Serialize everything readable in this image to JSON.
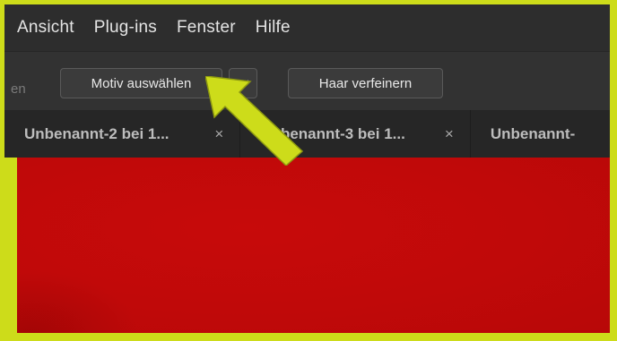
{
  "menubar": {
    "items": [
      {
        "label": "Ansicht"
      },
      {
        "label": "Plug-ins"
      },
      {
        "label": "Fenster"
      },
      {
        "label": "Hilfe"
      }
    ]
  },
  "options_bar": {
    "partial_label": "en",
    "select_subject_label": "Motiv auswählen",
    "refine_hair_label": "Haar verfeinern",
    "dropdown_icon": "chevron-down-icon"
  },
  "tabs": [
    {
      "label": "Unbenannt-2 bei 1...",
      "close": "×"
    },
    {
      "label": "Unbenannt-3 bei 1...",
      "close": "×"
    },
    {
      "label": "Unbenannt-"
    }
  ],
  "colors": {
    "highlight": "#cddc1a",
    "canvas": "#c00909",
    "ui_dark": "#2d2d2d"
  }
}
